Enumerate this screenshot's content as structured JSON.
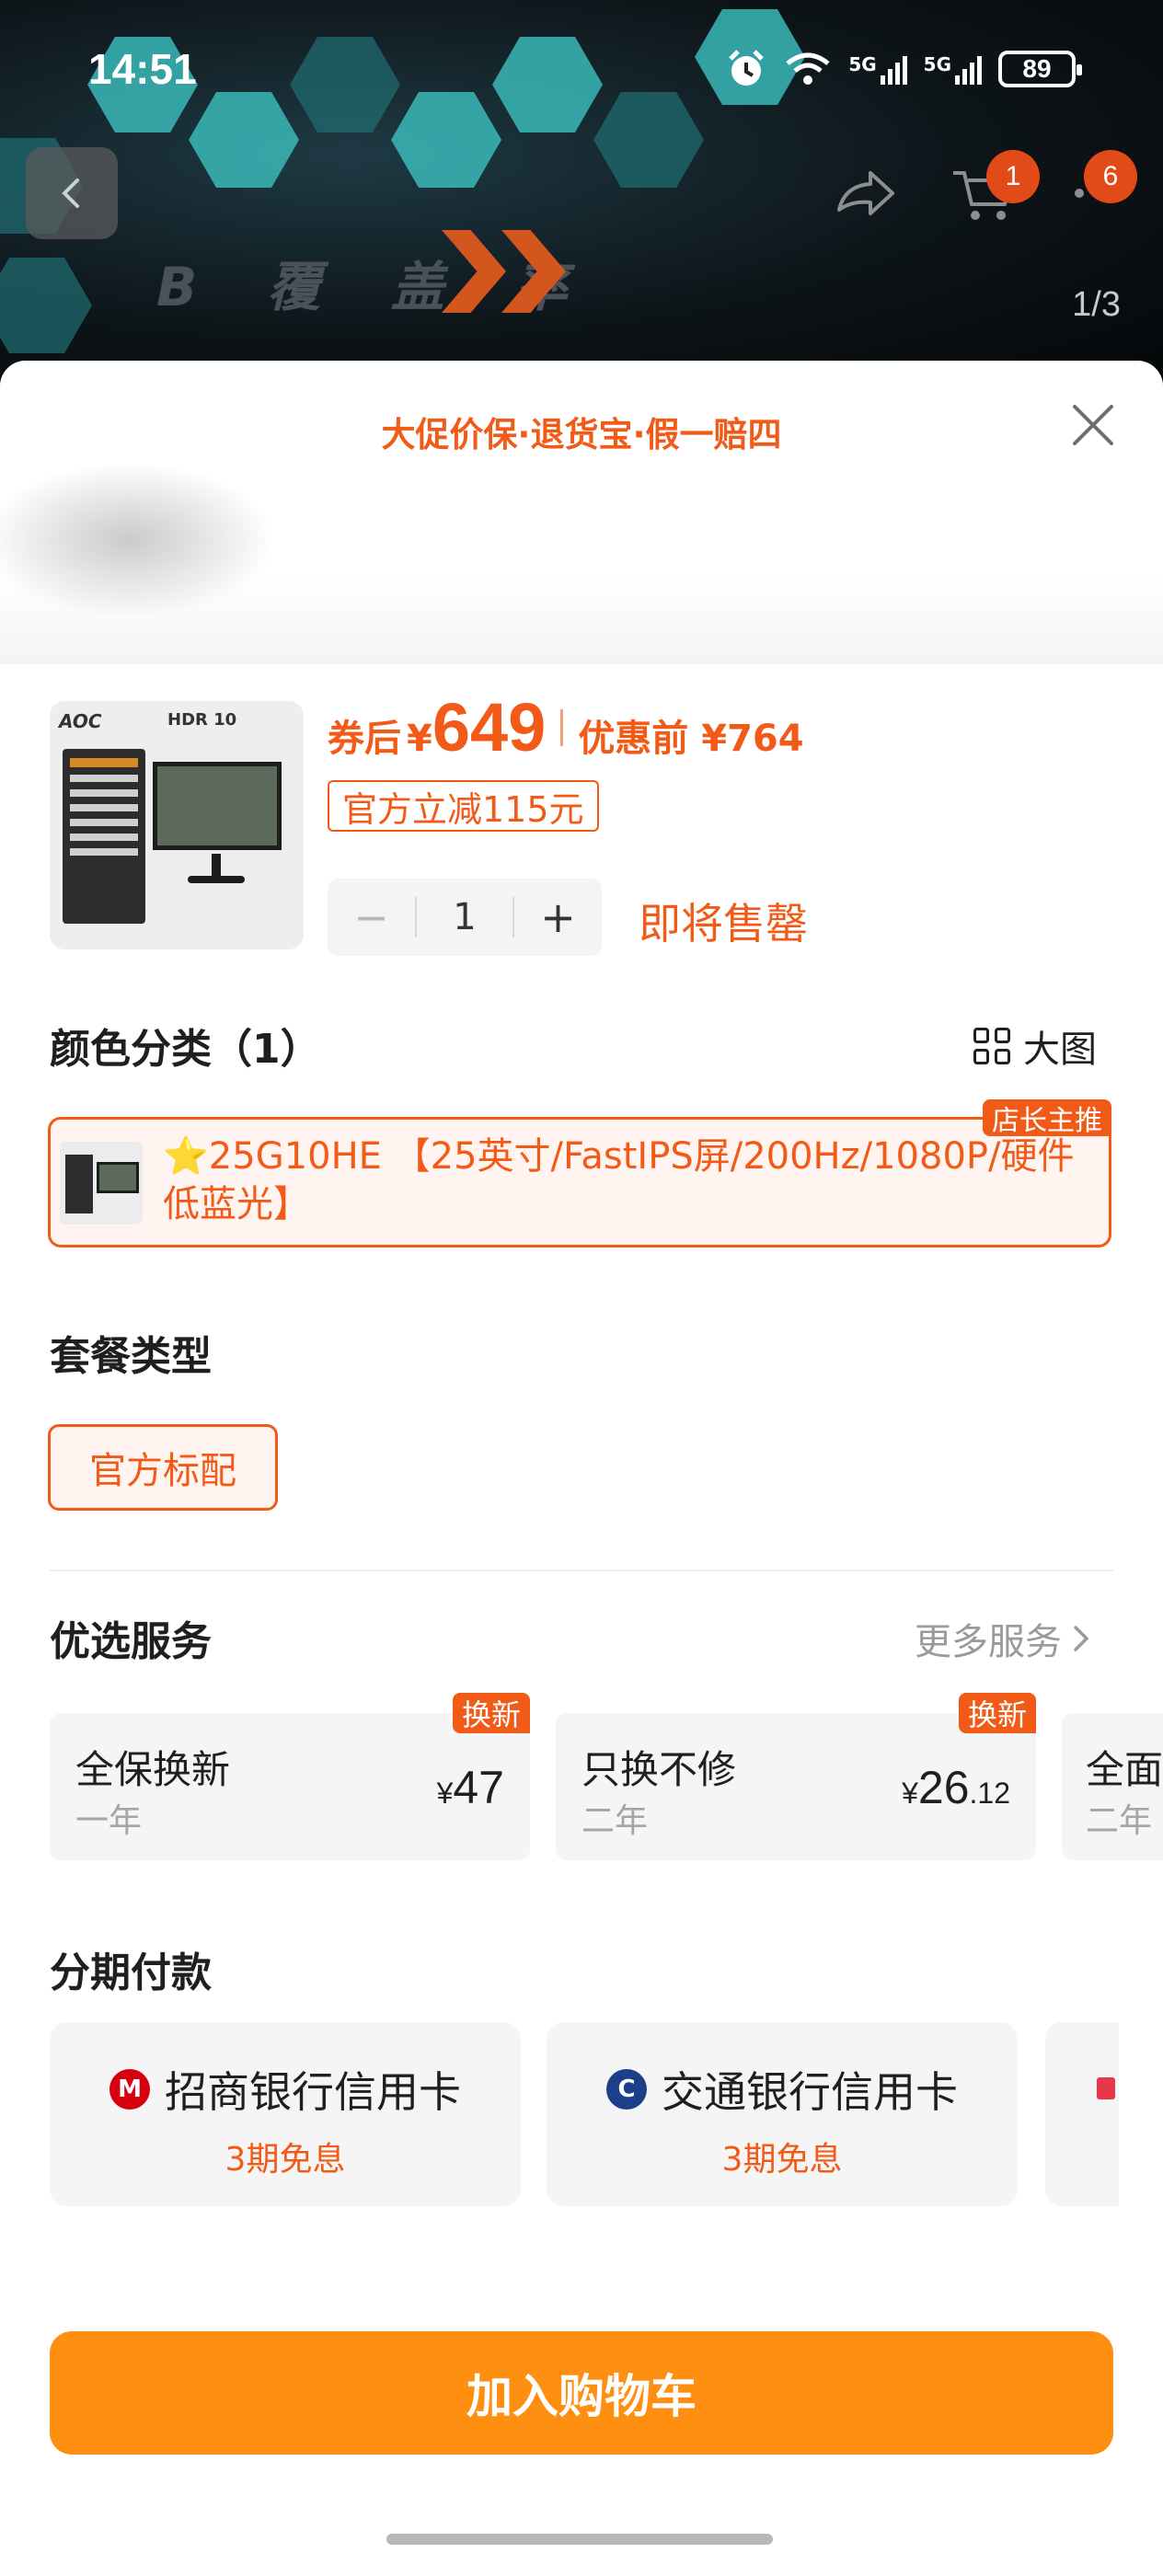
{
  "status_bar": {
    "time": "14:51",
    "net1": "5G",
    "net2": "5G",
    "battery": "89"
  },
  "header": {
    "cart_badge": "1",
    "more_badge": "6",
    "image_counter": "1/3",
    "banner_text": "B 覆 盖 率"
  },
  "sheet": {
    "promise": "大促价保·退货宝·假一赔四",
    "product": {
      "thumb_brand": "AOC",
      "thumb_hdr": "HDR 10",
      "price_prefix": "券后",
      "currency": "¥",
      "price": "649",
      "price_before": "优惠前 ¥764",
      "discount_tag": "官方立减115元",
      "quantity": "1",
      "minus_symbol": "−",
      "plus_symbol": "+",
      "stock_note": "即将售罄"
    },
    "color_section": {
      "title": "颜色分类（1）",
      "big_image_label": "大图",
      "variant_text": "⭐25G10HE 【25英寸/FastIPS屏/200Hz/1080P/硬件低蓝光】",
      "variant_badge": "店长主推"
    },
    "package_section": {
      "title": "套餐类型",
      "option": "官方标配"
    },
    "services_section": {
      "title": "优选服务",
      "more": "更多服务",
      "items": [
        {
          "name": "全保换新",
          "term": "一年",
          "yen": "¥",
          "price": "47",
          "decimal": "",
          "tag": "换新"
        },
        {
          "name": "只换不修",
          "term": "二年",
          "yen": "¥",
          "price": "26",
          "decimal": ".12",
          "tag": "换新"
        },
        {
          "name": "全面",
          "term": "二年"
        }
      ]
    },
    "installment_section": {
      "title": "分期付款",
      "banks": [
        {
          "name": "招商银行信用卡",
          "plan": "3期免息",
          "color": "#d7000f"
        },
        {
          "name": "交通银行信用卡",
          "plan": "3期免息",
          "color": "#1d3f8a"
        }
      ]
    },
    "add_to_cart": "加入购物车"
  },
  "colors": {
    "accent": "#f25a17",
    "cta": "#fe8f10"
  }
}
